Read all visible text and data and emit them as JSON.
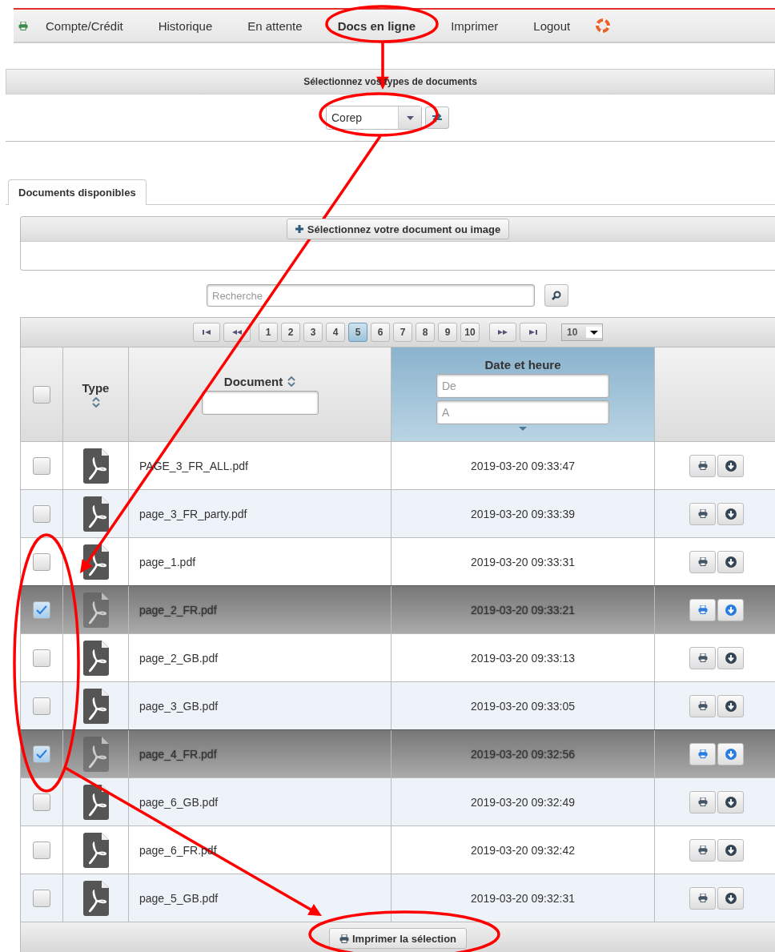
{
  "menu": [
    {
      "label": "Compte/Crédit",
      "selected": false
    },
    {
      "label": "Historique",
      "selected": false
    },
    {
      "label": "En attente",
      "selected": false
    },
    {
      "label": "Docs en ligne",
      "selected": true
    },
    {
      "label": "Imprimer",
      "selected": false
    },
    {
      "label": "Logout",
      "selected": false
    }
  ],
  "doc_types": {
    "title": "Sélectionnez vos types de documents",
    "value": "Corep"
  },
  "tabs": [
    {
      "label": "Documents disponibles",
      "selected": true
    }
  ],
  "upload_button": "Sélectionnez votre document ou image",
  "search": {
    "placeholder": "Recherche"
  },
  "pagination": {
    "pages": [
      {
        "label": "1",
        "selected": false
      },
      {
        "label": "2",
        "selected": false
      },
      {
        "label": "3",
        "selected": false
      },
      {
        "label": "4",
        "selected": false
      },
      {
        "label": "5",
        "selected": true
      },
      {
        "label": "6",
        "selected": false
      },
      {
        "label": "7",
        "selected": false
      },
      {
        "label": "8",
        "selected": false
      },
      {
        "label": "9",
        "selected": false
      },
      {
        "label": "10",
        "selected": false
      }
    ],
    "page_size": "10"
  },
  "columns": {
    "type": "Type",
    "document": "Document",
    "date": "Date et heure",
    "date_from": {
      "placeholder": "De"
    },
    "date_to": {
      "placeholder": "A"
    }
  },
  "select_all": {
    "checked": false
  },
  "rows": [
    {
      "name": "PAGE_3_FR_ALL.pdf",
      "date": "2019-03-20 09:33:47",
      "checked": false
    },
    {
      "name": "page_3_FR_party.pdf",
      "date": "2019-03-20 09:33:39",
      "checked": false
    },
    {
      "name": "page_1.pdf",
      "date": "2019-03-20 09:33:31",
      "checked": false
    },
    {
      "name": "page_2_FR.pdf",
      "date": "2019-03-20 09:33:21",
      "checked": true
    },
    {
      "name": "page_2_GB.pdf",
      "date": "2019-03-20 09:33:13",
      "checked": false
    },
    {
      "name": "page_3_GB.pdf",
      "date": "2019-03-20 09:33:05",
      "checked": false
    },
    {
      "name": "page_4_FR.pdf",
      "date": "2019-03-20 09:32:56",
      "checked": true
    },
    {
      "name": "page_6_GB.pdf",
      "date": "2019-03-20 09:32:49",
      "checked": false
    },
    {
      "name": "page_6_FR.pdf",
      "date": "2019-03-20 09:32:42",
      "checked": false
    },
    {
      "name": "page_5_GB.pdf",
      "date": "2019-03-20 09:32:31",
      "checked": false
    }
  ],
  "print_selection_button": "Imprimer la sélection"
}
